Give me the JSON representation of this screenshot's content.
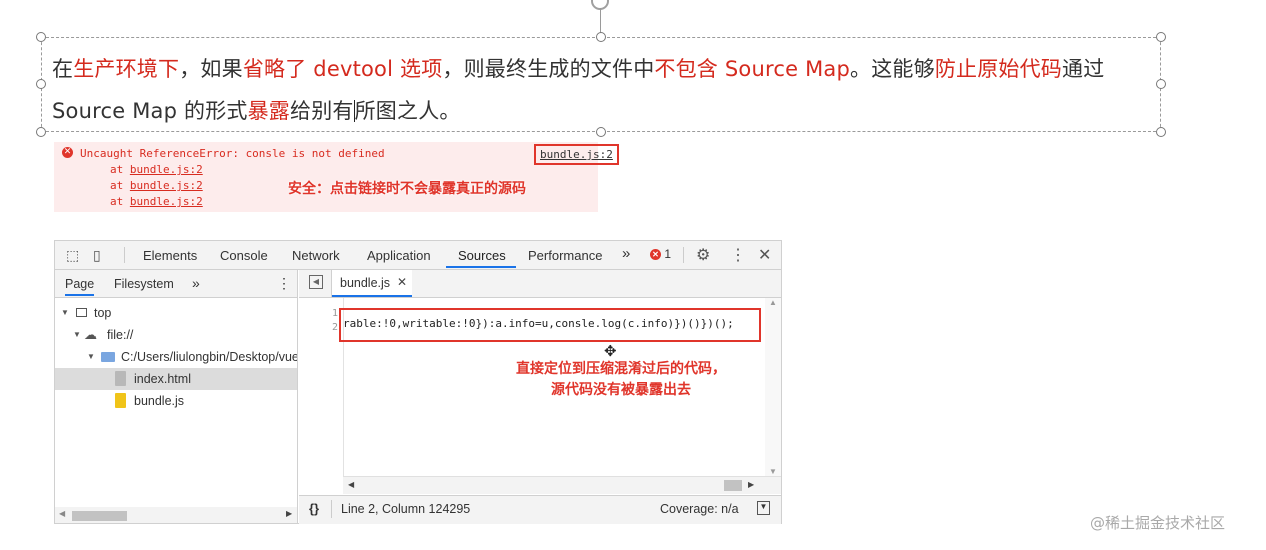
{
  "slide": {
    "segments": [
      {
        "t": "在",
        "h": false
      },
      {
        "t": "生产环境下",
        "h": true
      },
      {
        "t": "，如果",
        "h": false
      },
      {
        "t": "省略了 devtool 选项",
        "h": true
      },
      {
        "t": "，则最终生成的文件中",
        "h": false
      },
      {
        "t": "不包含 Source Map",
        "h": true
      },
      {
        "t": "。这能够",
        "h": false
      },
      {
        "t": "防止原始代码",
        "h": true
      },
      {
        "t": "通过 Source Map 的形式",
        "h": false
      },
      {
        "t": "暴露",
        "h": true
      },
      {
        "t": "给别有",
        "h": false
      },
      {
        "t": "所图之人。",
        "h": false
      }
    ]
  },
  "console_error": {
    "icon": "error-circle-icon",
    "message": "Uncaught ReferenceError: consle is not defined",
    "link": "bundle.js:2",
    "stack": [
      {
        "prefix": "at ",
        "link": "bundle.js:2"
      },
      {
        "prefix": "at ",
        "link": "bundle.js:2"
      },
      {
        "prefix": "at ",
        "link": "bundle.js:2"
      }
    ],
    "annotation": "安全：点击链接时不会暴露真正的源码"
  },
  "devtools": {
    "tabs": [
      "Elements",
      "Console",
      "Network",
      "Application",
      "Sources",
      "Performance"
    ],
    "active_tab": "Sources",
    "more": "»",
    "error_count": "1",
    "left_tabs": {
      "page": "Page",
      "filesystem": "Filesystem",
      "more": "»"
    },
    "tree": {
      "top": "top",
      "file": "file://",
      "folder": "C:/Users/liulongbin/Desktop/vue",
      "index": "index.html",
      "bundle": "bundle.js"
    },
    "editor_tab": "bundle.js",
    "line_numbers": [
      "1",
      "2"
    ],
    "code_line": "rable:!0,writable:!0}):a.info=u,consle.log(c.info)})()})();",
    "annotation_line1": "直接定位到压缩混淆过后的代码，",
    "annotation_line2": "源代码没有被暴露出去",
    "status": {
      "braces": "{}",
      "position": "Line 2, Column 124295",
      "coverage": "Coverage: n/a"
    }
  },
  "watermark": "@稀土掘金技术社区",
  "colors": {
    "highlight": "#d42a1e",
    "annotation": "#e0352b",
    "active_tab": "#1a73e8"
  }
}
